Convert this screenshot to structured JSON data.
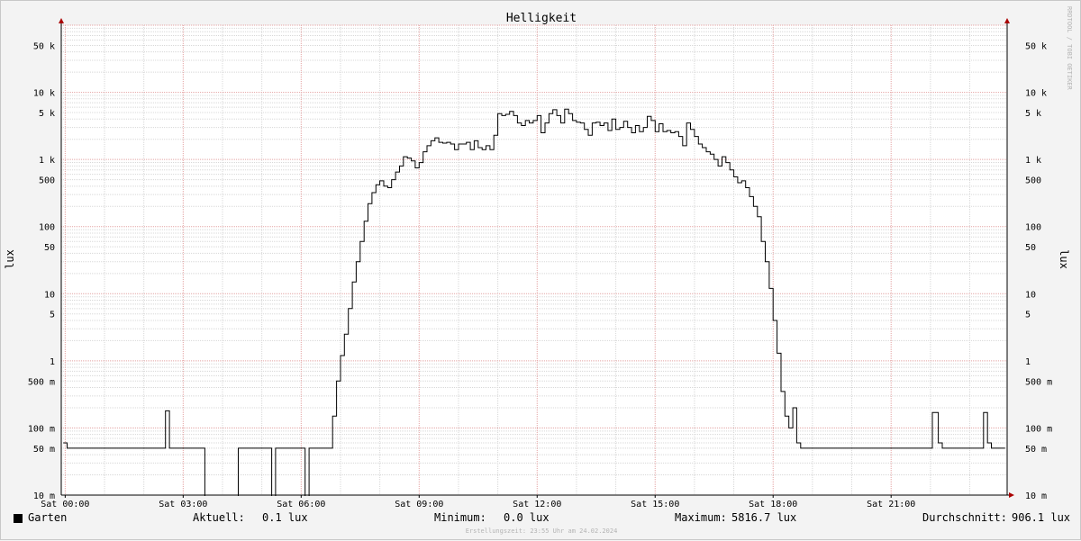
{
  "chart_data": {
    "type": "line",
    "title": "Helligkeit",
    "ylabel": "lux",
    "yscale": "log",
    "ylim": [
      0.01,
      100000
    ],
    "xlim": [
      -0.1,
      23.95
    ],
    "yticks": [
      {
        "value": 0.01,
        "label": "10 m"
      },
      {
        "value": 0.05,
        "label": "50 m"
      },
      {
        "value": 0.1,
        "label": "100 m"
      },
      {
        "value": 0.5,
        "label": "500 m"
      },
      {
        "value": 1,
        "label": "1"
      },
      {
        "value": 5,
        "label": "5"
      },
      {
        "value": 10,
        "label": "10"
      },
      {
        "value": 50,
        "label": "50"
      },
      {
        "value": 100,
        "label": "100"
      },
      {
        "value": 500,
        "label": "500"
      },
      {
        "value": 1000,
        "label": "1 k"
      },
      {
        "value": 5000,
        "label": "5 k"
      },
      {
        "value": 10000,
        "label": "10 k"
      },
      {
        "value": 50000,
        "label": "50 k"
      }
    ],
    "xticks": [
      {
        "value": 0,
        "label": "Sat 00:00"
      },
      {
        "value": 3,
        "label": "Sat 03:00"
      },
      {
        "value": 6,
        "label": "Sat 06:00"
      },
      {
        "value": 9,
        "label": "Sat 09:00"
      },
      {
        "value": 12,
        "label": "Sat 12:00"
      },
      {
        "value": 15,
        "label": "Sat 15:00"
      },
      {
        "value": 18,
        "label": "Sat 18:00"
      },
      {
        "value": 21,
        "label": "Sat 21:00"
      }
    ],
    "grid": true,
    "series": [
      {
        "name": "Garten",
        "color": "#000000",
        "points": [
          [
            -0.05,
            0.06
          ],
          [
            0.05,
            0.05
          ],
          [
            2.5,
            0.05
          ],
          [
            2.55,
            0.18
          ],
          [
            2.65,
            0.05
          ],
          [
            3.5,
            0.05
          ],
          [
            3.55,
            0.005
          ],
          [
            4.35,
            0.005
          ],
          [
            4.4,
            0.05
          ],
          [
            5.2,
            0.05
          ],
          [
            5.25,
            0.005
          ],
          [
            5.3,
            0.005
          ],
          [
            5.35,
            0.05
          ],
          [
            6.05,
            0.05
          ],
          [
            6.1,
            0.005
          ],
          [
            6.15,
            0.005
          ],
          [
            6.2,
            0.05
          ],
          [
            6.7,
            0.05
          ],
          [
            6.8,
            0.15
          ],
          [
            6.9,
            0.5
          ],
          [
            7.0,
            1.2
          ],
          [
            7.1,
            2.5
          ],
          [
            7.2,
            6
          ],
          [
            7.3,
            15
          ],
          [
            7.4,
            30
          ],
          [
            7.5,
            60
          ],
          [
            7.6,
            120
          ],
          [
            7.7,
            220
          ],
          [
            7.8,
            320
          ],
          [
            7.9,
            420
          ],
          [
            8.0,
            480
          ],
          [
            8.1,
            400
          ],
          [
            8.2,
            380
          ],
          [
            8.3,
            500
          ],
          [
            8.4,
            650
          ],
          [
            8.5,
            800
          ],
          [
            8.6,
            1100
          ],
          [
            8.7,
            1050
          ],
          [
            8.8,
            950
          ],
          [
            8.9,
            750
          ],
          [
            9.0,
            900
          ],
          [
            9.1,
            1300
          ],
          [
            9.2,
            1600
          ],
          [
            9.3,
            1900
          ],
          [
            9.4,
            2100
          ],
          [
            9.5,
            1800
          ],
          [
            9.6,
            1750
          ],
          [
            9.7,
            1800
          ],
          [
            9.8,
            1700
          ],
          [
            9.9,
            1400
          ],
          [
            10.0,
            1700
          ],
          [
            10.1,
            1700
          ],
          [
            10.2,
            1800
          ],
          [
            10.3,
            1400
          ],
          [
            10.4,
            1900
          ],
          [
            10.5,
            1500
          ],
          [
            10.6,
            1400
          ],
          [
            10.7,
            1600
          ],
          [
            10.8,
            1400
          ],
          [
            10.9,
            2300
          ],
          [
            11.0,
            4800
          ],
          [
            11.1,
            4500
          ],
          [
            11.2,
            4700
          ],
          [
            11.3,
            5200
          ],
          [
            11.4,
            4500
          ],
          [
            11.5,
            3500
          ],
          [
            11.6,
            3200
          ],
          [
            11.7,
            3800
          ],
          [
            11.8,
            3500
          ],
          [
            11.9,
            3800
          ],
          [
            12.0,
            4500
          ],
          [
            12.1,
            2500
          ],
          [
            12.2,
            3500
          ],
          [
            12.3,
            4800
          ],
          [
            12.4,
            5500
          ],
          [
            12.5,
            4500
          ],
          [
            12.6,
            3500
          ],
          [
            12.7,
            5600
          ],
          [
            12.8,
            4800
          ],
          [
            12.9,
            3800
          ],
          [
            13.0,
            3600
          ],
          [
            13.1,
            3500
          ],
          [
            13.2,
            2800
          ],
          [
            13.3,
            2300
          ],
          [
            13.4,
            3500
          ],
          [
            13.5,
            3600
          ],
          [
            13.6,
            3200
          ],
          [
            13.7,
            3500
          ],
          [
            13.8,
            2700
          ],
          [
            13.9,
            4000
          ],
          [
            14.0,
            2800
          ],
          [
            14.1,
            3000
          ],
          [
            14.2,
            3700
          ],
          [
            14.3,
            3000
          ],
          [
            14.4,
            2500
          ],
          [
            14.5,
            3200
          ],
          [
            14.6,
            2600
          ],
          [
            14.7,
            3000
          ],
          [
            14.8,
            4400
          ],
          [
            14.9,
            3800
          ],
          [
            15.0,
            2600
          ],
          [
            15.1,
            3400
          ],
          [
            15.2,
            2600
          ],
          [
            15.3,
            2700
          ],
          [
            15.4,
            2500
          ],
          [
            15.5,
            2600
          ],
          [
            15.6,
            2200
          ],
          [
            15.7,
            1600
          ],
          [
            15.8,
            3500
          ],
          [
            15.9,
            2800
          ],
          [
            16.0,
            2200
          ],
          [
            16.1,
            1700
          ],
          [
            16.2,
            1500
          ],
          [
            16.3,
            1300
          ],
          [
            16.4,
            1200
          ],
          [
            16.5,
            1000
          ],
          [
            16.6,
            800
          ],
          [
            16.7,
            1100
          ],
          [
            16.8,
            900
          ],
          [
            16.9,
            700
          ],
          [
            17.0,
            550
          ],
          [
            17.1,
            450
          ],
          [
            17.2,
            480
          ],
          [
            17.3,
            380
          ],
          [
            17.4,
            280
          ],
          [
            17.5,
            200
          ],
          [
            17.6,
            140
          ],
          [
            17.7,
            60
          ],
          [
            17.8,
            30
          ],
          [
            17.9,
            12
          ],
          [
            18.0,
            4
          ],
          [
            18.1,
            1.3
          ],
          [
            18.2,
            0.35
          ],
          [
            18.3,
            0.15
          ],
          [
            18.4,
            0.1
          ],
          [
            18.5,
            0.2
          ],
          [
            18.6,
            0.06
          ],
          [
            18.7,
            0.05
          ],
          [
            22.0,
            0.05
          ],
          [
            22.05,
            0.17
          ],
          [
            22.15,
            0.17
          ],
          [
            22.2,
            0.06
          ],
          [
            22.3,
            0.05
          ],
          [
            23.3,
            0.05
          ],
          [
            23.35,
            0.17
          ],
          [
            23.45,
            0.06
          ],
          [
            23.55,
            0.05
          ],
          [
            23.9,
            0.05
          ]
        ]
      }
    ]
  },
  "legend": {
    "series_name": "Garten",
    "current_label": "Aktuell:",
    "current_value": "0.1 lux",
    "min_label": "Minimum:",
    "min_value": "0.0 lux",
    "max_label": "Maximum:",
    "max_value": "5816.7 lux",
    "avg_label": "Durchschnitt:",
    "avg_value": "906.1 lux"
  },
  "footer": {
    "created": "Erstellungszeit: 23:55 Uhr am 24.02.2024"
  },
  "watermark": "RRDTOOL / TOBI OETIKER",
  "colors": {
    "background": "#f3f3f3",
    "plot_background": "#ffffff",
    "major_grid": "#e4a3a3",
    "minor_grid": "#d8d8d8",
    "axis": "#000000",
    "arrow": "#aa0000",
    "line": "#000000"
  }
}
